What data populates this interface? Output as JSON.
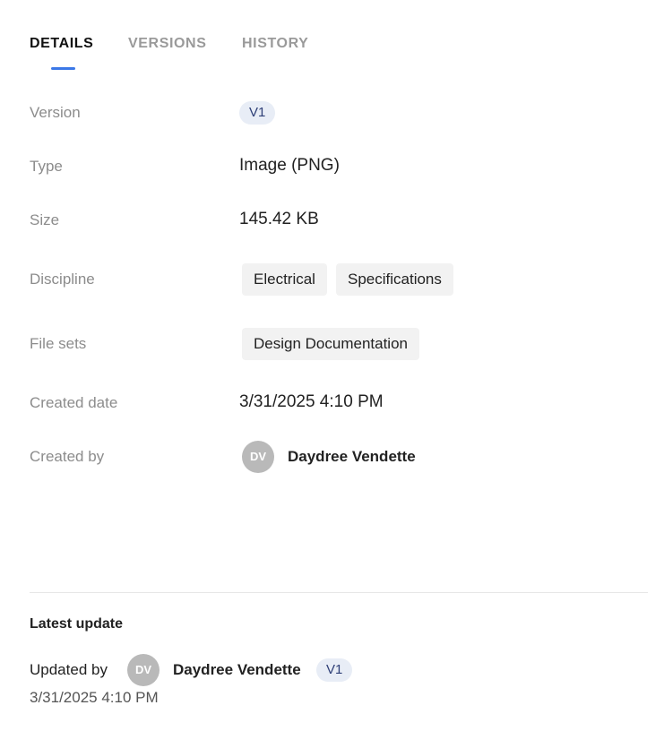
{
  "tabs": [
    {
      "label": "DETAILS",
      "active": true
    },
    {
      "label": "VERSIONS",
      "active": false
    },
    {
      "label": "HISTORY",
      "active": false
    }
  ],
  "details": {
    "version": {
      "label": "Version",
      "value": "V1"
    },
    "type": {
      "label": "Type",
      "value": "Image (PNG)"
    },
    "size": {
      "label": "Size",
      "value": "145.42 KB"
    },
    "discipline": {
      "label": "Discipline",
      "chips": [
        "Electrical",
        "Specifications"
      ]
    },
    "file_sets": {
      "label": "File sets",
      "chips": [
        "Design Documentation"
      ]
    },
    "created_date": {
      "label": "Created date",
      "value": "3/31/2025 4:10 PM"
    },
    "created_by": {
      "label": "Created by",
      "initials": "DV",
      "name": "Daydree Vendette"
    }
  },
  "latest_update": {
    "title": "Latest update",
    "updated_by_label": "Updated by",
    "initials": "DV",
    "name": "Daydree Vendette",
    "version": "V1",
    "date": "3/31/2025 4:10 PM"
  },
  "colors": {
    "accent": "#3b78e7",
    "version_pill_bg": "#e8edf6",
    "version_pill_text": "#2e3f77",
    "chip_bg": "#f2f2f2",
    "avatar_bg": "#b9b9b9"
  }
}
